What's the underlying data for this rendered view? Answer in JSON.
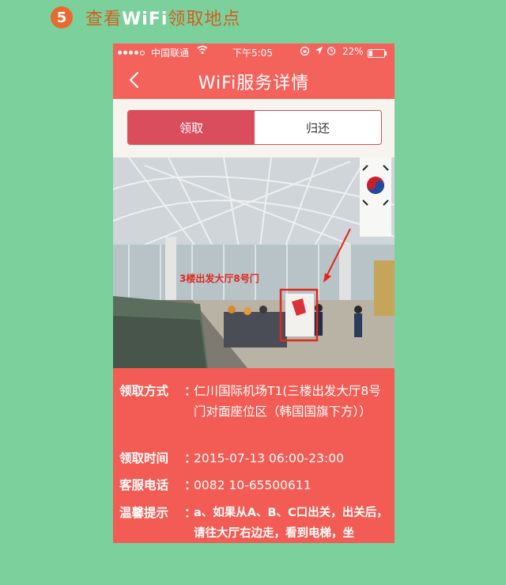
{
  "step": {
    "number": "5",
    "title_pre": "查看",
    "title_highlight": "WiFi",
    "title_post": "领取地点"
  },
  "statusbar": {
    "carrier": "中国联通",
    "time": "下午5:05",
    "battery": "22%",
    "battery_level": 0.22
  },
  "navbar": {
    "title": "WiFi服务详情",
    "back_icon": "chevron-left-icon"
  },
  "tabs": [
    {
      "label": "领取",
      "active": true
    },
    {
      "label": "归还",
      "active": false
    }
  ],
  "photo": {
    "annotation": "3楼出发大厅8号门"
  },
  "details": [
    {
      "label": "领取方式",
      "sep": "：",
      "value": "仁川国际机场T1(三楼出发大厅8号门对面座位区（韩国国旗下方））"
    },
    {
      "label": "领取时间",
      "sep": "：",
      "value": "2015-07-13 06:00-23:00"
    },
    {
      "label": "客服电话",
      "sep": "：",
      "value": "0082 10-65500611"
    },
    {
      "label": "温馨提示",
      "sep": "：",
      "value": "a、如果从A、B、C口出关，出关后，请往大厅右边走，看到电梯，坐"
    }
  ],
  "colors": {
    "background": "#7bd09b",
    "accent": "#f25c54",
    "segment_active": "#d94d5c",
    "step_circle": "#e8692e"
  }
}
